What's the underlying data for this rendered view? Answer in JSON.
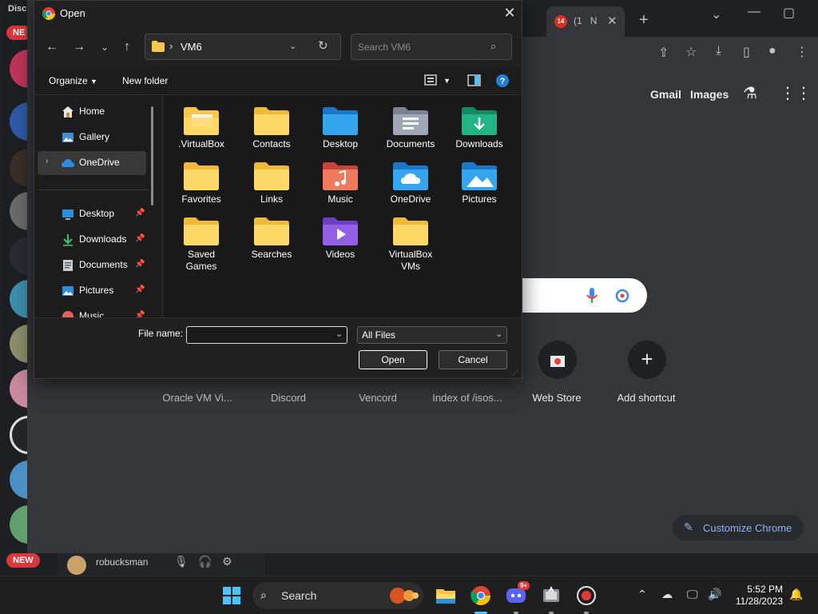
{
  "discord": {
    "title": "Disc",
    "new_badge_top": "NE",
    "new_badge_bottom": "NEW",
    "user_name": "robucksman"
  },
  "chrome": {
    "tab_badge": "14",
    "tab_text_1": "(1",
    "tab_text_2": "N",
    "ntp_links": {
      "gmail": "Gmail",
      "images": "Images"
    },
    "shortcuts": [
      {
        "label": "Oracle VM Vi..."
      },
      {
        "label": "Discord"
      },
      {
        "label": "Vencord"
      },
      {
        "label": "Index of /isos..."
      },
      {
        "label": "Web Store"
      },
      {
        "label": "Add shortcut"
      }
    ],
    "customize_label": "Customize Chrome"
  },
  "dialog": {
    "title": "Open",
    "address": {
      "separator": "›",
      "path": "VM6"
    },
    "search": {
      "placeholder": "Search VM6"
    },
    "commands": {
      "organize": "Organize",
      "new_folder": "New folder"
    },
    "nav": [
      {
        "label": "Home"
      },
      {
        "label": "Gallery"
      },
      {
        "label": "OneDrive"
      },
      {
        "label": "Desktop"
      },
      {
        "label": "Downloads"
      },
      {
        "label": "Documents"
      },
      {
        "label": "Pictures"
      },
      {
        "label": "Music"
      }
    ],
    "files": [
      {
        "name": ".VirtualBox"
      },
      {
        "name": "Contacts"
      },
      {
        "name": "Desktop"
      },
      {
        "name": "Documents"
      },
      {
        "name": "Downloads"
      },
      {
        "name": "Favorites"
      },
      {
        "name": "Links"
      },
      {
        "name": "Music"
      },
      {
        "name": "OneDrive"
      },
      {
        "name": "Pictures"
      },
      {
        "name": "Saved\nGames"
      },
      {
        "name": "Searches"
      },
      {
        "name": "Videos"
      },
      {
        "name": "VirtualBox\nVMs"
      }
    ],
    "file_name_label": "File name:",
    "file_name_value": "",
    "file_type": "All Files",
    "open_label": "Open",
    "cancel_label": "Cancel"
  },
  "taskbar": {
    "search_label": "Search",
    "discord_badge": "9+",
    "time": "5:52 PM",
    "date": "11/28/2023"
  },
  "colors": {
    "folder_yellow": "#f5c84c",
    "accent_blue": "#4cc2ff",
    "chrome_link": "#8ab4f8"
  }
}
